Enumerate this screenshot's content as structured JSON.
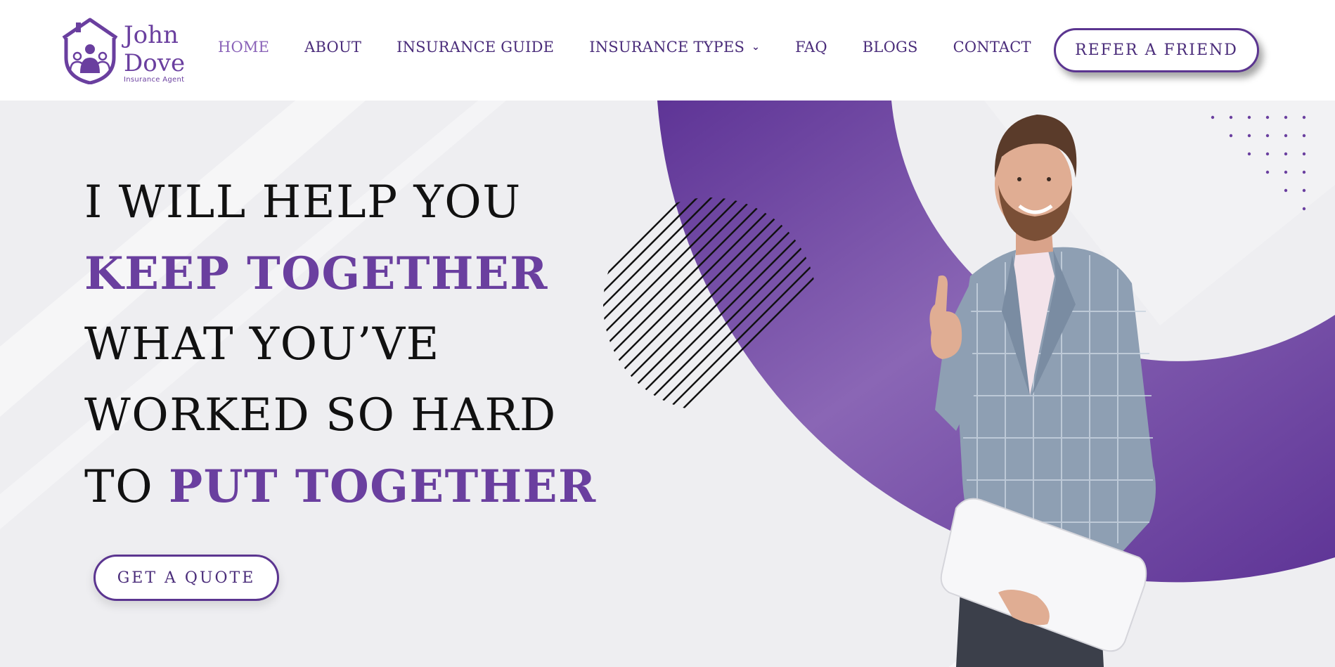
{
  "brand": {
    "name_line1": "John",
    "name_line2": "Dove",
    "tagline": "Insurance Agent"
  },
  "nav": {
    "items": [
      {
        "label": "HOME",
        "active": true
      },
      {
        "label": "ABOUT",
        "active": false
      },
      {
        "label": "INSURANCE GUIDE",
        "active": false
      },
      {
        "label": "INSURANCE TYPES",
        "active": false,
        "has_dropdown": true
      },
      {
        "label": "FAQ",
        "active": false
      },
      {
        "label": "BLOGS",
        "active": false
      },
      {
        "label": "CONTACT",
        "active": false
      }
    ],
    "refer_label": "REFER A FRIEND"
  },
  "hero": {
    "line1": "I WILL HELP YOU",
    "line2": "KEEP TOGETHER",
    "line3": "WHAT YOU’VE",
    "line4": "WORKED SO HARD",
    "line5_prefix": "TO ",
    "line5_accent": "PUT TOGETHER",
    "cta_label": "GET A QUOTE"
  },
  "colors": {
    "accent": "#6a3f9f",
    "nav_text": "#4a2c7a",
    "nav_active": "#8a63b8",
    "hero_bg": "#eeeef1",
    "headline": "#111111"
  },
  "icons": {
    "logo": "house-family-logo-icon",
    "dropdown": "chevron-down-icon"
  }
}
